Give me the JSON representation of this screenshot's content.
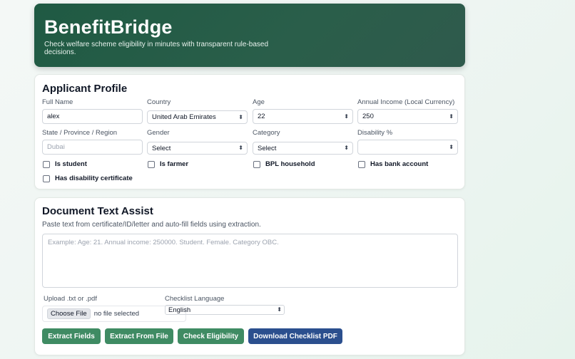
{
  "header": {
    "title": "BenefitBridge",
    "subtitle": "Check welfare scheme eligibility in minutes with transparent rule-based decisions."
  },
  "profile": {
    "title": "Applicant Profile",
    "full_name": {
      "label": "Full Name",
      "value": "alex"
    },
    "country": {
      "label": "Country",
      "value": "United Arab Emirates"
    },
    "age": {
      "label": "Age",
      "value": "22"
    },
    "income": {
      "label": "Annual Income (Local Currency)",
      "value": "250"
    },
    "state": {
      "label": "State / Province / Region",
      "placeholder": "Dubai"
    },
    "gender": {
      "label": "Gender",
      "value": "Select"
    },
    "category": {
      "label": "Category",
      "value": "Select"
    },
    "disability": {
      "label": "Disability %",
      "value": ""
    },
    "checkboxes": {
      "student": "Is student",
      "farmer": "Is farmer",
      "bpl": "BPL household",
      "bank": "Has bank account",
      "disability_cert": "Has disability certificate"
    }
  },
  "doc": {
    "title": "Document Text Assist",
    "description": "Paste text from certificate/ID/letter and auto-fill fields using extraction.",
    "textarea_placeholder": "Example: Age: 21. Annual income: 250000. Student. Female. Category OBC.",
    "upload_label": "Upload .txt or .pdf",
    "choose_file": "Choose File",
    "no_file": "no file selected",
    "language_label": "Checklist Language",
    "language_value": "English",
    "buttons": {
      "extract_fields": "Extract Fields",
      "extract_file": "Extract From File",
      "check": "Check Eligibility",
      "download": "Download Checklist PDF"
    }
  },
  "colors": {
    "header_bg": "#2a5e4a",
    "button_green": "#3f8b63",
    "button_blue": "#2b4f8e"
  }
}
